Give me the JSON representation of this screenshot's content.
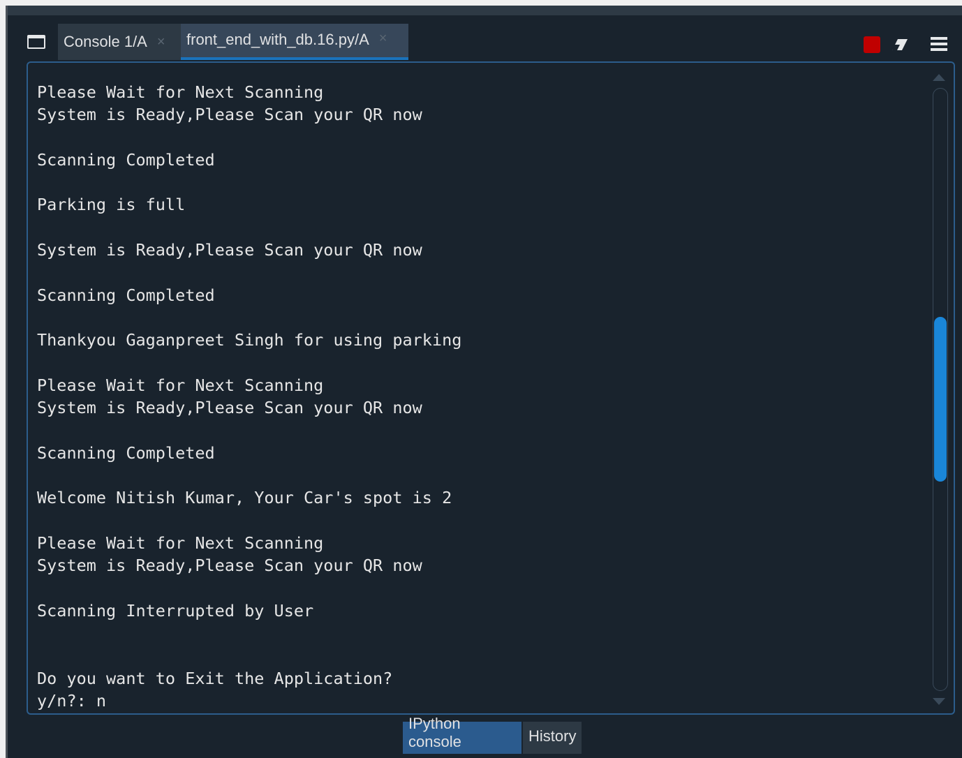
{
  "tabs": [
    {
      "label": "Console 1/A",
      "close": "×"
    },
    {
      "label": "front_end_with_db.16.py/A",
      "close": "×"
    }
  ],
  "toolbar": {
    "stop_icon": "stop-icon",
    "clear_icon": "eraser-icon",
    "menu_icon": "hamburger-menu-icon",
    "stop_color": "#c00000"
  },
  "console": {
    "lines": [
      "Please Wait for Next Scanning",
      "System is Ready,Please Scan your QR now",
      "",
      "Scanning Completed",
      "",
      "Parking is full",
      "",
      "System is Ready,Please Scan your QR now",
      "",
      "Scanning Completed",
      "",
      "Thankyou Gaganpreet Singh for using parking",
      "",
      "Please Wait for Next Scanning",
      "System is Ready,Please Scan your QR now",
      "",
      "Scanning Completed",
      "",
      "Welcome Nitish Kumar, Your Car's spot is 2",
      "",
      "Please Wait for Next Scanning",
      "System is Ready,Please Scan your QR now",
      "",
      "Scanning Interrupted by User",
      "",
      "",
      "Do you want to Exit the Application?",
      "y/n?: n"
    ]
  },
  "bottom_tabs": [
    {
      "label": "IPython console"
    },
    {
      "label": "History"
    }
  ],
  "colors": {
    "background": "#19232d",
    "accent": "#1a86d8",
    "text": "#e6e6e6"
  }
}
